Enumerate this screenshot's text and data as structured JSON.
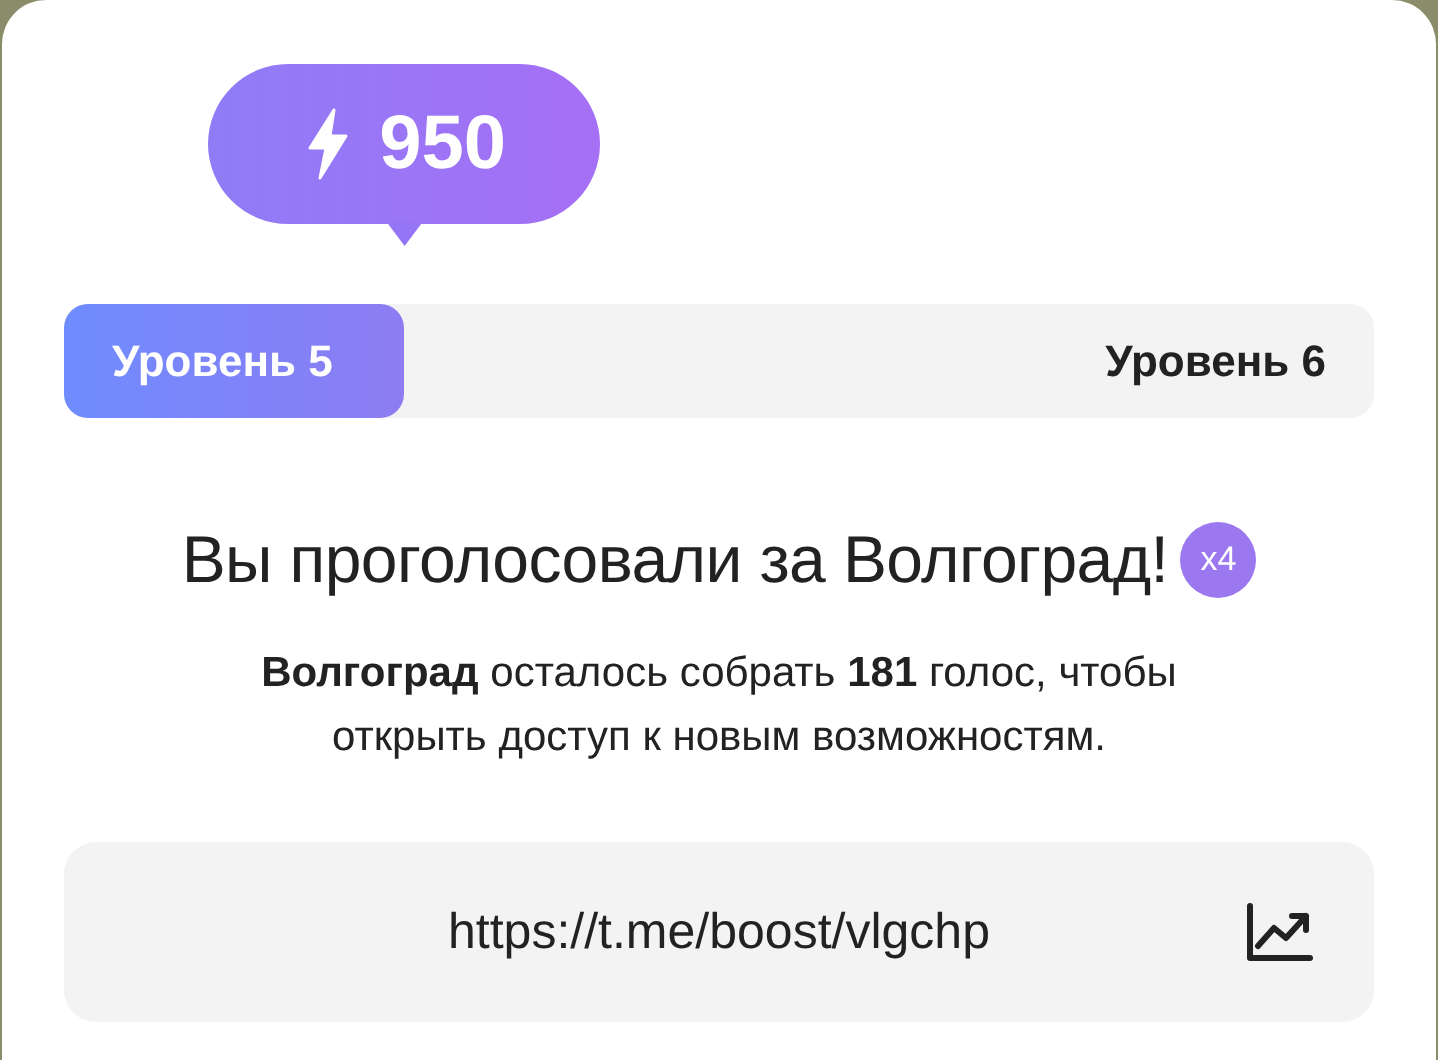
{
  "boost_badge": {
    "value": "950"
  },
  "level_bar": {
    "current_label": "Уровень 5",
    "next_label": "Уровень 6",
    "level": 0.26
  },
  "title": "Вы проголосовали за Волгоград!",
  "multiplier_badge": "x4",
  "description": "**Волгоград** осталось собрать **181** голос, чтобы открыть доступ к новым возможностям.",
  "link_field": {
    "value": "https://t.me/boost/vlgchp"
  }
}
